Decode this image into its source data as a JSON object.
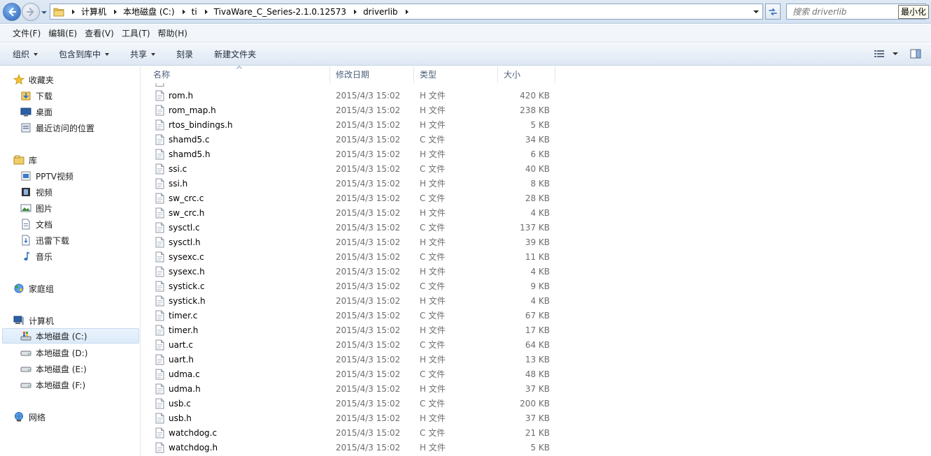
{
  "address": {
    "breadcrumbs": [
      "计算机",
      "本地磁盘 (C:)",
      "ti",
      "TivaWare_C_Series-2.1.0.12573",
      "driverlib"
    ]
  },
  "search": {
    "placeholder": "搜索 driverlib"
  },
  "tooltip": {
    "text": "最小化"
  },
  "menu": [
    "文件(F)",
    "编辑(E)",
    "查看(V)",
    "工具(T)",
    "帮助(H)"
  ],
  "commands": [
    {
      "label": "组织",
      "dropdown": true
    },
    {
      "label": "包含到库中",
      "dropdown": true
    },
    {
      "label": "共享",
      "dropdown": true
    },
    {
      "label": "刻录",
      "dropdown": false
    },
    {
      "label": "新建文件夹",
      "dropdown": false
    }
  ],
  "nav": {
    "favorites": {
      "label": "收藏夹",
      "items": [
        "下载",
        "桌面",
        "最近访问的位置"
      ]
    },
    "libraries": {
      "label": "库",
      "items": [
        "PPTV视频",
        "视频",
        "图片",
        "文档",
        "迅雷下载",
        "音乐"
      ]
    },
    "homegroup": {
      "label": "家庭组"
    },
    "computer": {
      "label": "计算机",
      "items": [
        "本地磁盘 (C:)",
        "本地磁盘 (D:)",
        "本地磁盘 (E:)",
        "本地磁盘 (F:)"
      ]
    },
    "network": {
      "label": "网络"
    }
  },
  "columns": {
    "name": "名称",
    "date": "修改日期",
    "type": "类型",
    "size": "大小"
  },
  "files": [
    {
      "name": "rom.h",
      "date": "2015/4/3 15:02",
      "type": "H 文件",
      "size": "420 KB"
    },
    {
      "name": "rom_map.h",
      "date": "2015/4/3 15:02",
      "type": "H 文件",
      "size": "238 KB"
    },
    {
      "name": "rtos_bindings.h",
      "date": "2015/4/3 15:02",
      "type": "H 文件",
      "size": "5 KB"
    },
    {
      "name": "shamd5.c",
      "date": "2015/4/3 15:02",
      "type": "C 文件",
      "size": "34 KB"
    },
    {
      "name": "shamd5.h",
      "date": "2015/4/3 15:02",
      "type": "H 文件",
      "size": "6 KB"
    },
    {
      "name": "ssi.c",
      "date": "2015/4/3 15:02",
      "type": "C 文件",
      "size": "40 KB"
    },
    {
      "name": "ssi.h",
      "date": "2015/4/3 15:02",
      "type": "H 文件",
      "size": "8 KB"
    },
    {
      "name": "sw_crc.c",
      "date": "2015/4/3 15:02",
      "type": "C 文件",
      "size": "28 KB"
    },
    {
      "name": "sw_crc.h",
      "date": "2015/4/3 15:02",
      "type": "H 文件",
      "size": "4 KB"
    },
    {
      "name": "sysctl.c",
      "date": "2015/4/3 15:02",
      "type": "C 文件",
      "size": "137 KB"
    },
    {
      "name": "sysctl.h",
      "date": "2015/4/3 15:02",
      "type": "H 文件",
      "size": "39 KB"
    },
    {
      "name": "sysexc.c",
      "date": "2015/4/3 15:02",
      "type": "C 文件",
      "size": "11 KB"
    },
    {
      "name": "sysexc.h",
      "date": "2015/4/3 15:02",
      "type": "H 文件",
      "size": "4 KB"
    },
    {
      "name": "systick.c",
      "date": "2015/4/3 15:02",
      "type": "C 文件",
      "size": "9 KB"
    },
    {
      "name": "systick.h",
      "date": "2015/4/3 15:02",
      "type": "H 文件",
      "size": "4 KB"
    },
    {
      "name": "timer.c",
      "date": "2015/4/3 15:02",
      "type": "C 文件",
      "size": "67 KB"
    },
    {
      "name": "timer.h",
      "date": "2015/4/3 15:02",
      "type": "H 文件",
      "size": "17 KB"
    },
    {
      "name": "uart.c",
      "date": "2015/4/3 15:02",
      "type": "C 文件",
      "size": "64 KB"
    },
    {
      "name": "uart.h",
      "date": "2015/4/3 15:02",
      "type": "H 文件",
      "size": "13 KB"
    },
    {
      "name": "udma.c",
      "date": "2015/4/3 15:02",
      "type": "C 文件",
      "size": "48 KB"
    },
    {
      "name": "udma.h",
      "date": "2015/4/3 15:02",
      "type": "H 文件",
      "size": "37 KB"
    },
    {
      "name": "usb.c",
      "date": "2015/4/3 15:02",
      "type": "C 文件",
      "size": "200 KB"
    },
    {
      "name": "usb.h",
      "date": "2015/4/3 15:02",
      "type": "H 文件",
      "size": "37 KB"
    },
    {
      "name": "watchdog.c",
      "date": "2015/4/3 15:02",
      "type": "C 文件",
      "size": "21 KB"
    },
    {
      "name": "watchdog.h",
      "date": "2015/4/3 15:02",
      "type": "H 文件",
      "size": "5 KB"
    }
  ]
}
